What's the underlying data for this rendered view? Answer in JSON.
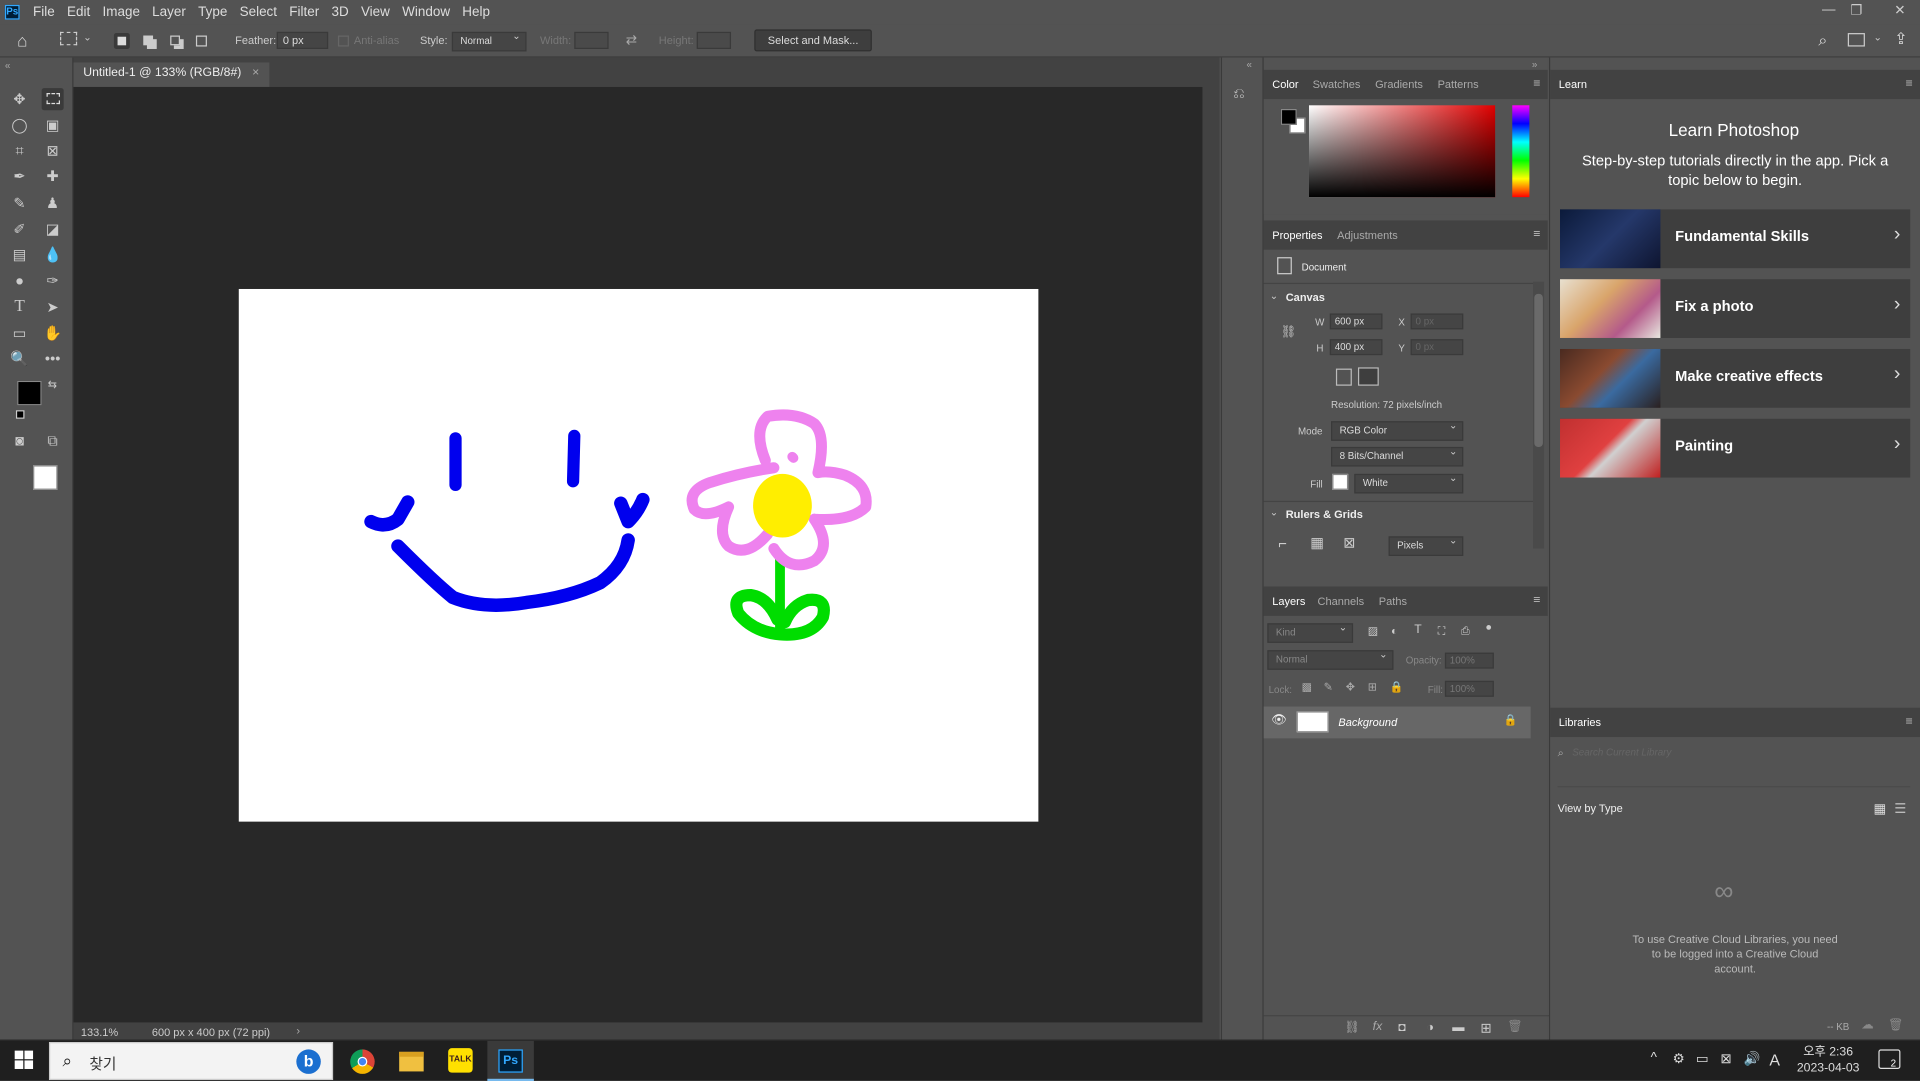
{
  "app": {
    "logo": "Ps"
  },
  "menu": [
    "File",
    "Edit",
    "Image",
    "Layer",
    "Type",
    "Select",
    "Filter",
    "3D",
    "View",
    "Window",
    "Help"
  ],
  "options": {
    "feather_label": "Feather:",
    "feather_value": "0 px",
    "antialias_label": "Anti-alias",
    "style_label": "Style:",
    "style_value": "Normal",
    "width_label": "Width:",
    "height_label": "Height:",
    "select_mask": "Select and Mask..."
  },
  "document": {
    "tab_title": "Untitled-1 @ 133% (RGB/8#)",
    "zoom": "133.1%",
    "doc_info": "600 px x 400 px (72 ppi)"
  },
  "color_panel": {
    "tabs": [
      "Color",
      "Swatches",
      "Gradients",
      "Patterns"
    ],
    "active": "Color"
  },
  "properties": {
    "tabs": [
      "Properties",
      "Adjustments"
    ],
    "doc_label": "Document",
    "canvas_section": "Canvas",
    "w_label": "W",
    "w_value": "600 px",
    "h_label": "H",
    "h_value": "400 px",
    "x_label": "X",
    "x_placeholder": "0 px",
    "y_label": "Y",
    "y_placeholder": "0 px",
    "resolution": "Resolution: 72 pixels/inch",
    "mode_label": "Mode",
    "mode_value": "RGB Color",
    "bits_value": "8 Bits/Channel",
    "fill_label": "Fill",
    "fill_value": "White",
    "rulers_section": "Rulers & Grids",
    "units_value": "Pixels"
  },
  "layers": {
    "tabs": [
      "Layers",
      "Channels",
      "Paths"
    ],
    "kind_placeholder": "Kind",
    "blend_mode": "Normal",
    "opacity_label": "Opacity:",
    "opacity_value": "100%",
    "lock_label": "Lock:",
    "fill_label": "Fill:",
    "fill_value": "100%",
    "items": [
      {
        "name": "Background"
      }
    ]
  },
  "learn": {
    "tab": "Learn",
    "title": "Learn Photoshop",
    "subtitle": "Step-by-step tutorials directly in the app. Pick a topic below to begin.",
    "cards": [
      {
        "label": "Fundamental Skills"
      },
      {
        "label": "Fix a photo"
      },
      {
        "label": "Make creative effects"
      },
      {
        "label": "Painting"
      }
    ]
  },
  "libraries": {
    "tab": "Libraries",
    "search_placeholder": "Search Current Library",
    "view_by": "View by Type",
    "message": "To use Creative Cloud Libraries, you need to be logged into a Creative Cloud account.",
    "size": "-- KB"
  },
  "taskbar": {
    "search_placeholder": "찾기",
    "time": "오후 2:36",
    "date": "2023-04-03",
    "ime": "A",
    "notif_count": "2"
  },
  "colors": {
    "face": "#0000ee",
    "petal": "#ee82ee",
    "center": "#ffee00",
    "stem": "#00dd00"
  }
}
